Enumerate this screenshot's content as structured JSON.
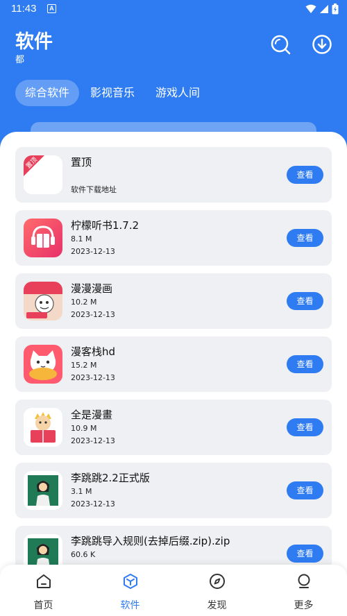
{
  "status": {
    "time": "11:43",
    "badge": "A"
  },
  "header": {
    "title": "软件",
    "subtitle": "都"
  },
  "tabs": [
    {
      "label": "综合软件",
      "active": true
    },
    {
      "label": "影视音乐",
      "active": false
    },
    {
      "label": "游戏人间",
      "active": false
    }
  ],
  "apps": [
    {
      "name": "置顶",
      "size": "",
      "date": "软件下载地址",
      "icon": "pinned-badge-icon",
      "button": "查看"
    },
    {
      "name": "柠檬听书1.7.2",
      "size": "8.1 M",
      "date": "2023-12-13",
      "icon": "lemon-audiobook-icon",
      "button": "查看"
    },
    {
      "name": " 漫漫漫画",
      "size": "10.2 M",
      "date": "2023-12-13",
      "icon": "manman-comic-icon",
      "button": "查看"
    },
    {
      "name": " 漫客栈hd",
      "size": "15.2 M",
      "date": "2023-12-13",
      "icon": "mankezhan-cat-icon",
      "button": "查看"
    },
    {
      "name": " 全是漫畫",
      "size": "10.9 M",
      "date": "2023-12-13",
      "icon": "reading-boy-icon",
      "button": "查看"
    },
    {
      "name": "李跳跳2.2正式版",
      "size": "3.1 M",
      "date": "2023-12-13",
      "icon": "litiaotiao-girl-icon",
      "button": "查看"
    },
    {
      "name": " 李跳跳导入规则(去掉后缀.zip).zip",
      "size": "60.6 K",
      "date": "",
      "icon": "litiaotiao-girl-icon",
      "button": "查看"
    }
  ],
  "nav": [
    {
      "label": "首页",
      "icon": "home-icon",
      "active": false
    },
    {
      "label": "软件",
      "icon": "cube-icon",
      "active": true
    },
    {
      "label": "发现",
      "icon": "compass-icon",
      "active": false
    },
    {
      "label": "更多",
      "icon": "more-icon",
      "active": false
    }
  ],
  "colors": {
    "primary": "#2f7cf2",
    "card": "#eef0f3"
  }
}
